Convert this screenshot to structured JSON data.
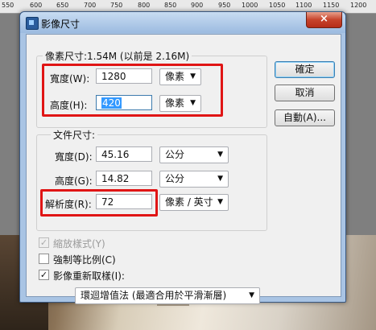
{
  "ruler": {
    "ticks": [
      "550",
      "600",
      "650",
      "700",
      "750",
      "800",
      "850",
      "900",
      "950",
      "1000",
      "1050",
      "1100",
      "1150",
      "1200"
    ]
  },
  "dialog": {
    "title": "影像尺寸",
    "close_label": "×",
    "buttons": {
      "ok": "確定",
      "cancel": "取消",
      "auto": "自動(A)..."
    },
    "pixel_dimensions": {
      "header": "像素尺寸:1.54M (以前是 2.16M)",
      "width_label": "寬度(W):",
      "width_value": "1280",
      "width_unit": "像素",
      "height_label": "高度(H):",
      "height_value": "420",
      "height_unit": "像素"
    },
    "document_size": {
      "header": "文件尺寸:",
      "width_label": "寬度(D):",
      "width_value": "45.16",
      "width_unit": "公分",
      "height_label": "高度(G):",
      "height_value": "14.82",
      "height_unit": "公分",
      "resolution_label": "解析度(R):",
      "resolution_value": "72",
      "resolution_unit": "像素 / 英寸"
    },
    "options": {
      "scale_styles": "縮放樣式(Y)",
      "scale_styles_checked": true,
      "constrain": "強制等比例(C)",
      "constrain_checked": false,
      "resample": "影像重新取樣(I):",
      "resample_checked": true,
      "resample_method": "環迴增值法 (最適合用於平滑漸層)"
    }
  },
  "colors": {
    "highlight_box": "#e01515",
    "selection": "#3399ff"
  }
}
